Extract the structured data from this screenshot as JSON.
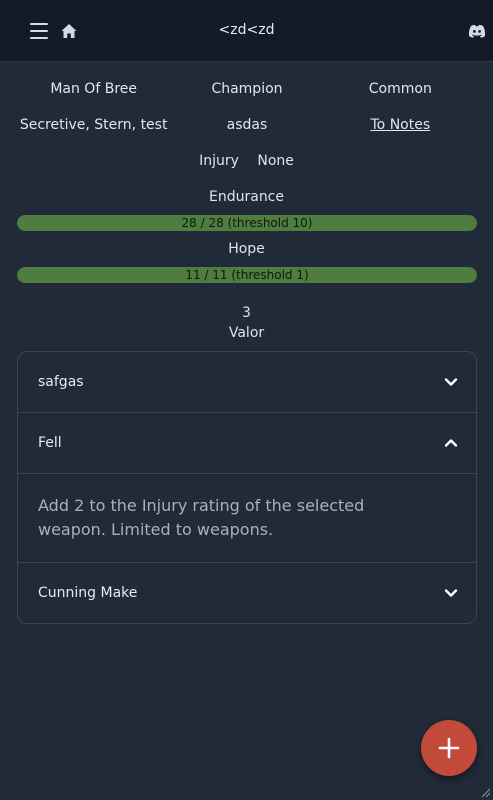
{
  "header": {
    "title": "<zd<zd"
  },
  "info": {
    "row1": [
      "Man Of Bree",
      "Champion",
      "Common"
    ],
    "row2": [
      "Secretive, Stern, test",
      "asdas"
    ],
    "notes_link": "To Notes",
    "injury_label": "Injury",
    "injury_value": "None"
  },
  "endurance": {
    "label": "Endurance",
    "text": "28 / 28 (threshold 10)",
    "current": 28,
    "max": 28
  },
  "hope": {
    "label": "Hope",
    "text": "11 / 11 (threshold 1)",
    "current": 11,
    "max": 11
  },
  "valor": {
    "value": "3",
    "label": "Valor"
  },
  "accordion": {
    "items": [
      {
        "label": "safgas",
        "expanded": false
      },
      {
        "label": "Fell",
        "expanded": true,
        "body": "Add 2 to the Injury rating of the selected weapon. Limited to weapons."
      },
      {
        "label": "Cunning Make",
        "expanded": false
      }
    ]
  },
  "colors": {
    "bar": "#4e7d3f",
    "fab": "#c3493b",
    "header_bg": "#141b28",
    "page_bg": "#212a38"
  },
  "icons": {
    "menu": "menu-icon",
    "home": "home-icon",
    "discord": "discord-icon",
    "add": "plus-icon"
  }
}
